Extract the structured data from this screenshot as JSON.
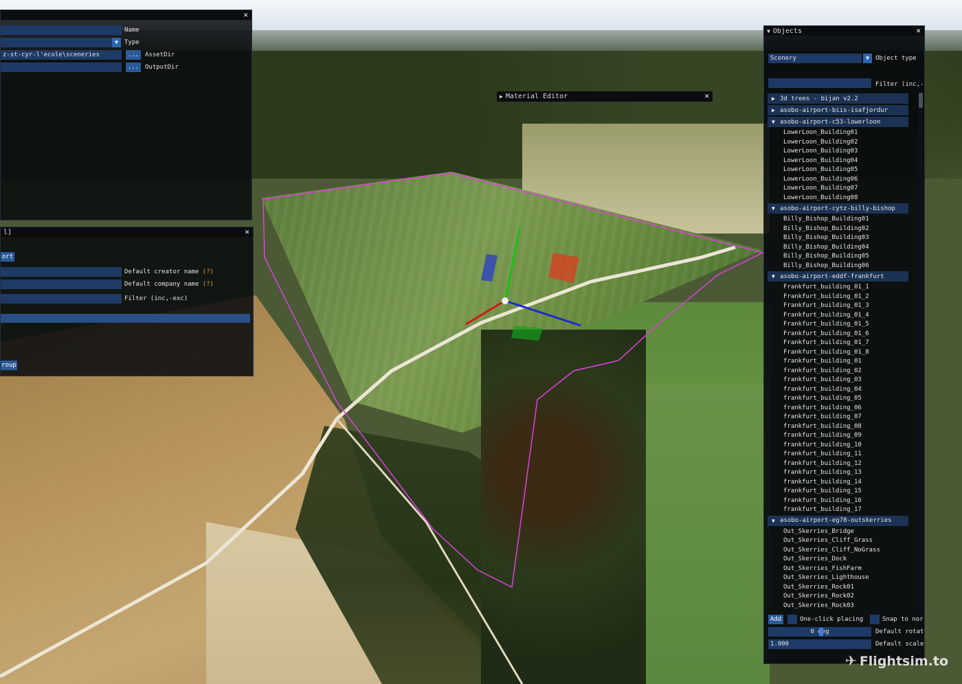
{
  "scenery_window": {
    "fields": [
      {
        "value": "",
        "label": "Name"
      },
      {
        "value": "",
        "label": "Type"
      },
      {
        "value": "z-st-cyr-l'ecole\\sceneries",
        "label": "AssetDir"
      },
      {
        "value": "",
        "label": "OutputDir"
      }
    ],
    "browse_label": "...",
    "close_icon": "✕"
  },
  "project_window": {
    "title": "l]",
    "export_btn": "ort",
    "creator_label": "Default creator name",
    "company_label": "Default company name",
    "help_mark": "(?)",
    "filter_label": "Filter (inc,-exc)",
    "group_btn": "roup",
    "close_icon": "✕"
  },
  "material_editor": {
    "title": "Material Editor",
    "close_icon": "✕"
  },
  "objects_window": {
    "title": "Objects",
    "type_value": "Scenery",
    "type_label": "Object type",
    "filter_label": "Filter (inc,-",
    "groups": [
      {
        "name": "3d trees - bijan v2.2",
        "expanded": false,
        "items": []
      },
      {
        "name": "asobo-airport-biis-isafjordur",
        "expanded": false,
        "items": []
      },
      {
        "name": "asobo-airport-c53-lowerloon",
        "expanded": true,
        "items": [
          "LowerLoon_Building01",
          "LowerLoon_Building02",
          "LowerLoon_Building03",
          "LowerLoon_Building04",
          "LowerLoon_Building05",
          "LowerLoon_Building06",
          "LowerLoon_Building07",
          "LowerLoon_Building08"
        ]
      },
      {
        "name": "asobo-airport-cytz-billy-bishop",
        "expanded": true,
        "items": [
          "Billy_Bishop_Building01",
          "Billy_Bishop_Building02",
          "Billy_Bishop_Building03",
          "Billy_Bishop_Building04",
          "Billy_Bishop_Building05",
          "Billy_Bishop_Building06"
        ]
      },
      {
        "name": "asobo-airport-eddf-frankfurt",
        "expanded": true,
        "items": [
          "Frankfurt_building_01_1",
          "Frankfurt_building_01_2",
          "Frankfurt_building_01_3",
          "Frankfurt_building_01_4",
          "Frankfurt_building_01_5",
          "Frankfurt_building_01_6",
          "Frankfurt_building_01_7",
          "Frankfurt_building_01_8",
          "frankfurt_building_01",
          "frankfurt_building_02",
          "frankfurt_building_03",
          "frankfurt_building_04",
          "frankfurt_building_05",
          "frankfurt_building_06",
          "frankfurt_building_07",
          "frankfurt_building_08",
          "frankfurt_building_09",
          "frankfurt_building_10",
          "frankfurt_building_11",
          "frankfurt_building_12",
          "frankfurt_building_13",
          "frankfurt_building_14",
          "frankfurt_building_15",
          "frankfurt_building_16",
          "frankfurt_building_17"
        ]
      },
      {
        "name": "asobo-airport-eg78-outskerries",
        "expanded": true,
        "items": [
          "Out_Skerries_Bridge",
          "Out_Skerries_Cliff_Grass",
          "Out_Skerries_Cliff_NoGrass",
          "Out_Skerries_Dock",
          "Out_Skerries_FishFarm",
          "Out_Skerries_Lighthouse",
          "Out_Skerries_Rock01",
          "Out_Skerries_Rock02",
          "Out_Skerries_Rock03"
        ]
      }
    ],
    "add_btn": "Add",
    "one_click_label": "One-click placing",
    "snap_label": "Snap to nor",
    "rotation_value": "0 deg",
    "rotation_label": "Default rotat",
    "scale_value": "1.000",
    "scale_label": "Default scale",
    "close_icon": "✕"
  },
  "watermark": "Flightsim.to",
  "icons": {
    "collapsed": "▶",
    "expanded": "▼",
    "dropdown": "▼",
    "plane": "✈"
  },
  "colors": {
    "window_bg": "#080a0e",
    "field_bg": "#1e3a66",
    "button_bg": "#2a5a9a",
    "help_mark": "#d9a23a",
    "polygon": "#e040e0"
  }
}
